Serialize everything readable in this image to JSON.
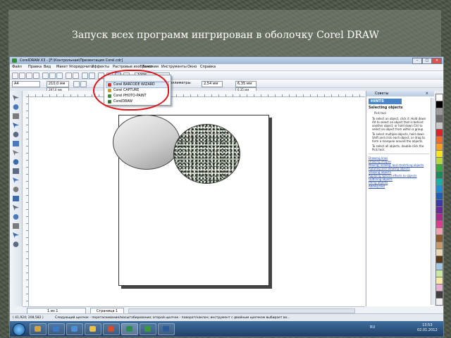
{
  "slide": {
    "title": "Запуск всех программ ингрирован в оболочку Corel DRAW"
  },
  "window": {
    "title": "CorelDRAW X3 - [F:\\Контрольная\\Презентация Corel.cdr]",
    "menu": [
      "Файл",
      "Правка",
      "Вид",
      "Макет",
      "Упорядочить",
      "Эффекты",
      "Растровые изображения",
      "Текст",
      "Инструменты",
      "Окно",
      "Справка"
    ]
  },
  "toolbar": {
    "zoom_value": "100%",
    "app_launcher": {
      "items": [
        "Corel BARCODE WIZARD",
        "Corel CAPTURE",
        "Corel PHOTO-PAINT",
        "CorelDRAW"
      ],
      "icon_colors": [
        "#d8352a",
        "#c9a02a",
        "#3b8f3b",
        "#2f7d2f"
      ]
    }
  },
  "propbar": {
    "paper": "A4",
    "width": "210,0 мм",
    "height": "297,0 мм",
    "units_label": "Единицы: миллиметры",
    "nudge": "2,54 мм",
    "dup_x": "6,35 мм",
    "dup_y": "6,35 мм"
  },
  "page_nav": {
    "page_counter": "1 из 1",
    "page_tab": "Страница 1"
  },
  "statusbar": {
    "coords": "( 41,924; 208,582 )",
    "hint": "Следующий щелчок - перетаскивание/масштабирование; второй щелчок - поворот/наклон; инструмент с двойным щелчком выбирает во..."
  },
  "docker": {
    "title": "Советы",
    "hints_label": "HINTS",
    "heading": "Selecting objects",
    "tool": "Pick tool",
    "steps": [
      "To select an object, click it. Hold down Alt to select an object that is behind another object, or hold down Ctrl to select an object from within a group.",
      "To select multiple objects, hold down Shift and click each object, or drag to form a marquee around the objects.",
      "To select all objects, double-click the Pick tool."
    ],
    "links": [
      "Drawing lines",
      "Drawing shapes",
      "Moving, scaling, and stretching objects",
      "Rotating and skewing objects",
      "Shaping objects",
      "Applying special effects to objects",
      "Outlining objects",
      "Filling objects",
      "Adding text"
    ]
  },
  "palette": [
    "#ffffff",
    "#000000",
    "#9a9a9a",
    "#6e6e6e",
    "#c8c8c8",
    "#e0202a",
    "#f06a2a",
    "#f5a020",
    "#f7e21c",
    "#b8d93a",
    "#35a840",
    "#1b8a5a",
    "#1ab0a8",
    "#1c8fd6",
    "#1d5fb8",
    "#3a3aa8",
    "#6a2a9a",
    "#a82a8a",
    "#e23a8a",
    "#f4a0b0",
    "#8a5a2a",
    "#c89a6a",
    "#e8d8b0",
    "#5a3a1a",
    "#a0c8e8",
    "#c8e8a0",
    "#f8e8a0",
    "#e8b0d0",
    "#404040",
    "#f0f0f0"
  ],
  "taskbar": {
    "apps": [
      {
        "color": "#d8a43a",
        "active": false
      },
      {
        "color": "#3a78c8",
        "active": false
      },
      {
        "color": "#4a8fd8",
        "active": false
      },
      {
        "color": "#f0c040",
        "active": false
      },
      {
        "color": "#d84a2a",
        "active": false
      },
      {
        "color": "#2a8f4a",
        "active": true
      },
      {
        "color": "#3a9a3a",
        "active": false
      },
      {
        "color": "#2a5a9a",
        "active": false
      }
    ],
    "lang": "RU",
    "time": "13:53",
    "date": "02.01.2012"
  }
}
